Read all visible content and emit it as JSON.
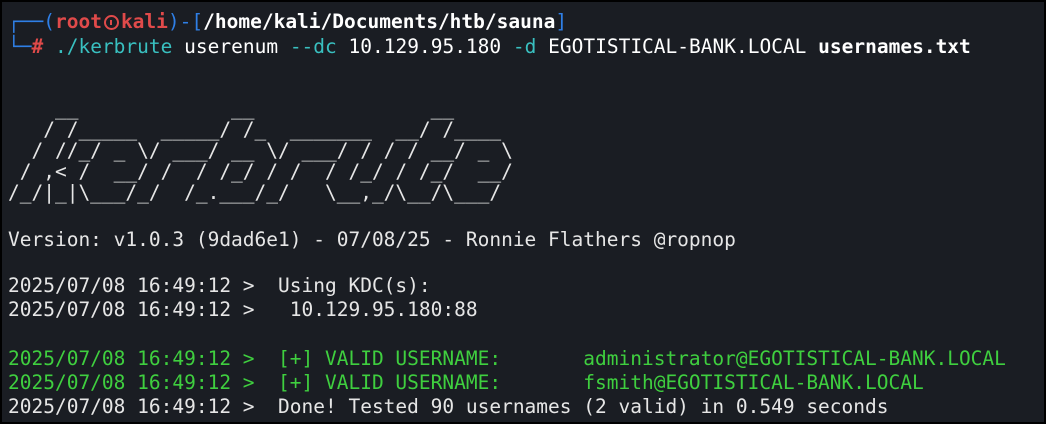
{
  "prompt": {
    "line1_open": "┌──(",
    "user": "root",
    "host": "kali",
    "line1_mid": ")-[",
    "path": "/home/kali/Documents/htb/sauna",
    "line1_close": "]",
    "line2_prefix": "└─",
    "hash": "#",
    "command_exec": "./kerbrute",
    "command_sub": "userenum",
    "flag_dc": "--dc",
    "dc_value": "10.129.95.180",
    "flag_d": "-d",
    "domain_value": "EGOTISTICAL-BANK.LOCAL",
    "file_arg": "usernames.txt"
  },
  "banner": {
    "ascii": "    __             __               __     \n   / /_____  _____/ /_  _______  __/ /____ \n  / //_/ _ \\/ ___/ __ \\/ ___/ / / / __/ _ \\\n / ,< /  __/ /  / /_/ / /  / /_/ / /_/  __/\n/_/|_|\\___/_/  /_.___/_/   \\__,_/\\__/\\___/ "
  },
  "output": {
    "version": "Version: v1.0.3 (9dad6e1) - 07/08/25 - Ronnie Flathers @ropnop",
    "kdc_line": "2025/07/08 16:49:12 >  Using KDC(s):",
    "kdc_addr": "2025/07/08 16:49:12 >   10.129.95.180:88",
    "valid1": "2025/07/08 16:49:12 >  [+] VALID USERNAME:       administrator@EGOTISTICAL-BANK.LOCAL",
    "valid2": "2025/07/08 16:49:12 >  [+] VALID USERNAME:       fsmith@EGOTISTICAL-BANK.LOCAL",
    "done": "2025/07/08 16:49:12 >  Done! Tested 90 usernames (2 valid) in 0.549 seconds"
  },
  "colors": {
    "background": "#1a1d23",
    "prompt_blue": "#2f7fe6",
    "prompt_red": "#e04a4a",
    "command_cyan": "#39c0c0",
    "success_green": "#3fcf3f",
    "text": "#e6e6e6"
  },
  "icons": {
    "user_host_separator": "skull-icon"
  }
}
